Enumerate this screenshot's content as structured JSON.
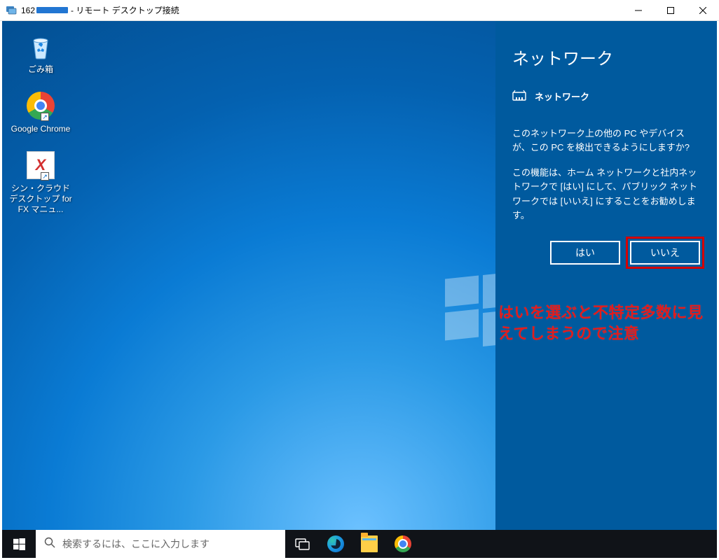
{
  "titlebar": {
    "prefix": "162",
    "suffix": " - リモート デスクトップ接続"
  },
  "desktop_icons": {
    "recycle": "ごみ箱",
    "chrome": "Google Chrome",
    "app": "シン・クラウドデスクトップ for FX マニュ..."
  },
  "network_panel": {
    "title": "ネットワーク",
    "section_label": "ネットワーク",
    "msg1": "このネットワーク上の他の PC やデバイスが、この PC を検出できるようにしますか?",
    "msg2": "この機能は、ホーム ネットワークと社内ネットワークで [はい] にして、パブリック ネットワークでは [いいえ] にすることをお勧めします。",
    "yes": "はい",
    "no": "いいえ"
  },
  "annotation": "はいを選ぶと不特定多数に見えてしまうので注意",
  "taskbar": {
    "search_placeholder": "検索するには、ここに入力します"
  }
}
